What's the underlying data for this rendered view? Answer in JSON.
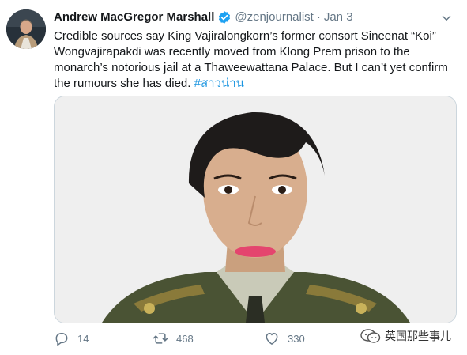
{
  "tweet": {
    "author_name": "Andrew MacGregor Marshall",
    "handle": "@zenjournalist",
    "separator": "·",
    "date": "Jan 3",
    "text": "Credible sources say King Vajiralongkorn’s former consort Sineenat “Koi” Wongvajirapakdi was recently moved from Klong Prem prison to the monarch’s notorious jail at a Thaweewattana Palace. But I can’t yet confirm the rumours she has died.",
    "hashtag": "#สาวน่าน",
    "accent_color": "#1da1f2",
    "hashtag_color": "#1b95e0"
  },
  "icons": {
    "verified": "verified-badge-icon",
    "more": "chevron-down-icon",
    "reply": "reply-icon",
    "retweet": "retweet-icon",
    "like": "heart-icon"
  },
  "actions": {
    "replies": "14",
    "retweets": "468",
    "likes": "330"
  },
  "watermark": {
    "text": "英国那些事儿"
  }
}
